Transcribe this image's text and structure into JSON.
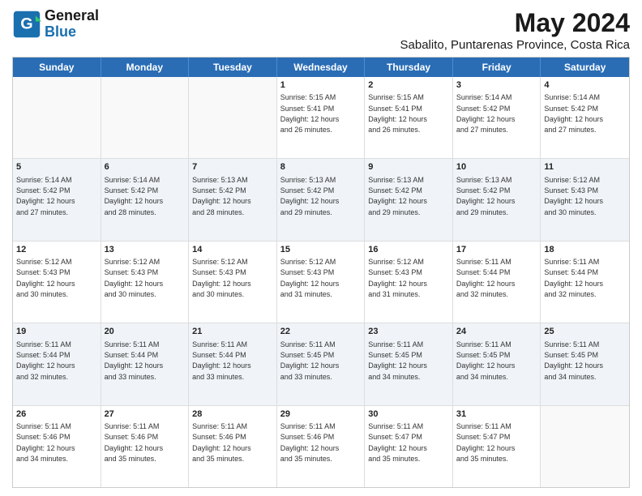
{
  "header": {
    "logo_general": "General",
    "logo_blue": "Blue",
    "title": "May 2024",
    "subtitle": "Sabalito, Puntarenas Province, Costa Rica"
  },
  "calendar": {
    "days": [
      "Sunday",
      "Monday",
      "Tuesday",
      "Wednesday",
      "Thursday",
      "Friday",
      "Saturday"
    ],
    "rows": [
      [
        {
          "day": "",
          "text": ""
        },
        {
          "day": "",
          "text": ""
        },
        {
          "day": "",
          "text": ""
        },
        {
          "day": "1",
          "text": "Sunrise: 5:15 AM\nSunset: 5:41 PM\nDaylight: 12 hours\nand 26 minutes."
        },
        {
          "day": "2",
          "text": "Sunrise: 5:15 AM\nSunset: 5:41 PM\nDaylight: 12 hours\nand 26 minutes."
        },
        {
          "day": "3",
          "text": "Sunrise: 5:14 AM\nSunset: 5:42 PM\nDaylight: 12 hours\nand 27 minutes."
        },
        {
          "day": "4",
          "text": "Sunrise: 5:14 AM\nSunset: 5:42 PM\nDaylight: 12 hours\nand 27 minutes."
        }
      ],
      [
        {
          "day": "5",
          "text": "Sunrise: 5:14 AM\nSunset: 5:42 PM\nDaylight: 12 hours\nand 27 minutes."
        },
        {
          "day": "6",
          "text": "Sunrise: 5:14 AM\nSunset: 5:42 PM\nDaylight: 12 hours\nand 28 minutes."
        },
        {
          "day": "7",
          "text": "Sunrise: 5:13 AM\nSunset: 5:42 PM\nDaylight: 12 hours\nand 28 minutes."
        },
        {
          "day": "8",
          "text": "Sunrise: 5:13 AM\nSunset: 5:42 PM\nDaylight: 12 hours\nand 29 minutes."
        },
        {
          "day": "9",
          "text": "Sunrise: 5:13 AM\nSunset: 5:42 PM\nDaylight: 12 hours\nand 29 minutes."
        },
        {
          "day": "10",
          "text": "Sunrise: 5:13 AM\nSunset: 5:42 PM\nDaylight: 12 hours\nand 29 minutes."
        },
        {
          "day": "11",
          "text": "Sunrise: 5:12 AM\nSunset: 5:43 PM\nDaylight: 12 hours\nand 30 minutes."
        }
      ],
      [
        {
          "day": "12",
          "text": "Sunrise: 5:12 AM\nSunset: 5:43 PM\nDaylight: 12 hours\nand 30 minutes."
        },
        {
          "day": "13",
          "text": "Sunrise: 5:12 AM\nSunset: 5:43 PM\nDaylight: 12 hours\nand 30 minutes."
        },
        {
          "day": "14",
          "text": "Sunrise: 5:12 AM\nSunset: 5:43 PM\nDaylight: 12 hours\nand 30 minutes."
        },
        {
          "day": "15",
          "text": "Sunrise: 5:12 AM\nSunset: 5:43 PM\nDaylight: 12 hours\nand 31 minutes."
        },
        {
          "day": "16",
          "text": "Sunrise: 5:12 AM\nSunset: 5:43 PM\nDaylight: 12 hours\nand 31 minutes."
        },
        {
          "day": "17",
          "text": "Sunrise: 5:11 AM\nSunset: 5:44 PM\nDaylight: 12 hours\nand 32 minutes."
        },
        {
          "day": "18",
          "text": "Sunrise: 5:11 AM\nSunset: 5:44 PM\nDaylight: 12 hours\nand 32 minutes."
        }
      ],
      [
        {
          "day": "19",
          "text": "Sunrise: 5:11 AM\nSunset: 5:44 PM\nDaylight: 12 hours\nand 32 minutes."
        },
        {
          "day": "20",
          "text": "Sunrise: 5:11 AM\nSunset: 5:44 PM\nDaylight: 12 hours\nand 33 minutes."
        },
        {
          "day": "21",
          "text": "Sunrise: 5:11 AM\nSunset: 5:44 PM\nDaylight: 12 hours\nand 33 minutes."
        },
        {
          "day": "22",
          "text": "Sunrise: 5:11 AM\nSunset: 5:45 PM\nDaylight: 12 hours\nand 33 minutes."
        },
        {
          "day": "23",
          "text": "Sunrise: 5:11 AM\nSunset: 5:45 PM\nDaylight: 12 hours\nand 34 minutes."
        },
        {
          "day": "24",
          "text": "Sunrise: 5:11 AM\nSunset: 5:45 PM\nDaylight: 12 hours\nand 34 minutes."
        },
        {
          "day": "25",
          "text": "Sunrise: 5:11 AM\nSunset: 5:45 PM\nDaylight: 12 hours\nand 34 minutes."
        }
      ],
      [
        {
          "day": "26",
          "text": "Sunrise: 5:11 AM\nSunset: 5:46 PM\nDaylight: 12 hours\nand 34 minutes."
        },
        {
          "day": "27",
          "text": "Sunrise: 5:11 AM\nSunset: 5:46 PM\nDaylight: 12 hours\nand 35 minutes."
        },
        {
          "day": "28",
          "text": "Sunrise: 5:11 AM\nSunset: 5:46 PM\nDaylight: 12 hours\nand 35 minutes."
        },
        {
          "day": "29",
          "text": "Sunrise: 5:11 AM\nSunset: 5:46 PM\nDaylight: 12 hours\nand 35 minutes."
        },
        {
          "day": "30",
          "text": "Sunrise: 5:11 AM\nSunset: 5:47 PM\nDaylight: 12 hours\nand 35 minutes."
        },
        {
          "day": "31",
          "text": "Sunrise: 5:11 AM\nSunset: 5:47 PM\nDaylight: 12 hours\nand 35 minutes."
        },
        {
          "day": "",
          "text": ""
        }
      ]
    ]
  }
}
